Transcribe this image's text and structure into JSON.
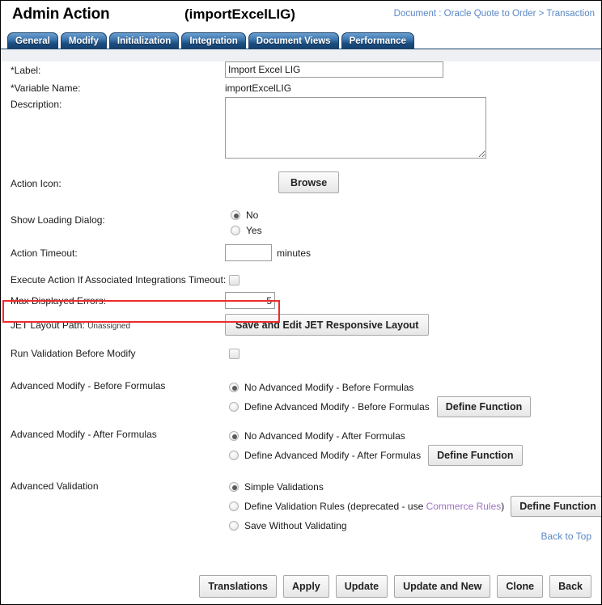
{
  "header": {
    "title": "Admin Action",
    "variable_display": "(importExcelLIG)",
    "breadcrumb": "Document : Oracle Quote to Order > Transaction"
  },
  "tabs": [
    {
      "label": "General",
      "active": true
    },
    {
      "label": "Modify",
      "active": false
    },
    {
      "label": "Initialization",
      "active": false
    },
    {
      "label": "Integration",
      "active": false
    },
    {
      "label": "Document Views",
      "active": false
    },
    {
      "label": "Performance",
      "active": false
    }
  ],
  "form": {
    "label_field": {
      "label": "*Label:",
      "value": "Import Excel LIG",
      "placeholder": ""
    },
    "variable_name": {
      "label": "*Variable Name:",
      "value": "importExcelLIG"
    },
    "description": {
      "label": "Description:",
      "value": "",
      "placeholder": ""
    },
    "action_icon": {
      "label": "Action Icon:",
      "button": "Browse"
    },
    "show_loading_dialog": {
      "label": "Show Loading Dialog:",
      "options": [
        {
          "text": "No",
          "selected": true
        },
        {
          "text": "Yes",
          "selected": false
        }
      ]
    },
    "action_timeout": {
      "label": "Action Timeout:",
      "value": "",
      "suffix": "minutes"
    },
    "execute_action_if_timeout": {
      "label": "Execute Action If Associated Integrations Timeout:",
      "checked": false
    },
    "max_displayed_errors": {
      "label": "Max Displayed Errors:",
      "value": "5",
      "highlight_color": "#ef2b2b"
    },
    "jet_layout_path": {
      "label": "JET Layout Path:",
      "value": "Unassigned",
      "button": "Save and Edit JET Responsive Layout"
    },
    "run_validation_before_modify": {
      "label": "Run Validation Before Modify",
      "checked": false
    },
    "advanced_modify_before": {
      "label": "Advanced Modify - Before Formulas",
      "options": [
        {
          "text": "No Advanced Modify - Before Formulas",
          "selected": true
        },
        {
          "text": "Define Advanced Modify - Before Formulas",
          "selected": false
        }
      ],
      "button": "Define Function"
    },
    "advanced_modify_after": {
      "label": "Advanced Modify - After Formulas",
      "options": [
        {
          "text": "No Advanced Modify - After Formulas",
          "selected": true
        },
        {
          "text": "Define Advanced Modify - After Formulas",
          "selected": false
        }
      ],
      "button": "Define Function"
    },
    "advanced_validation": {
      "label": "Advanced Validation",
      "options": [
        {
          "text": "Simple Validations",
          "selected": true
        },
        {
          "text": "Define Validation Rules (deprecated - use ",
          "link": "Commerce Rules",
          "text_after": ")",
          "selected": false
        },
        {
          "text": "Save Without Validating",
          "selected": false
        }
      ],
      "button": "Define Function"
    },
    "back_to_top": "Back to Top"
  },
  "footer_buttons": [
    {
      "label": "Translations"
    },
    {
      "label": "Apply"
    },
    {
      "label": "Update"
    },
    {
      "label": "Update and New"
    },
    {
      "label": "Clone"
    },
    {
      "label": "Back"
    }
  ]
}
